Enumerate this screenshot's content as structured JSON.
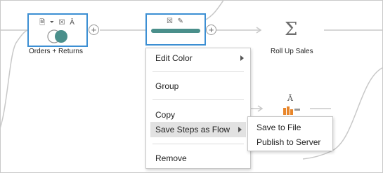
{
  "nodes": {
    "orders_returns": {
      "label": "Orders + Returns"
    },
    "rollup": {
      "label": "Roll Up Sales",
      "symbol": "Σ"
    },
    "lower_step": {
      "symbol": "Ā"
    }
  },
  "node_icons": {
    "glyphs": "🗎 ⏷ ☒ Ā",
    "selected_glyphs": "☒ ✎"
  },
  "context_menu": {
    "items": [
      {
        "label": "Edit Color",
        "has_submenu": true
      },
      {
        "label": "Group"
      },
      {
        "label": "Copy"
      },
      {
        "label": "Save Steps as Flow",
        "has_submenu": true,
        "highlighted": true
      },
      {
        "label": "Remove"
      }
    ]
  },
  "submenu": {
    "items": [
      {
        "label": "Save to File"
      },
      {
        "label": "Publish to Server"
      }
    ]
  },
  "colors": {
    "selection_border": "#3c8fd3",
    "teal": "#4a8f8b",
    "orange": "#e8862b"
  }
}
